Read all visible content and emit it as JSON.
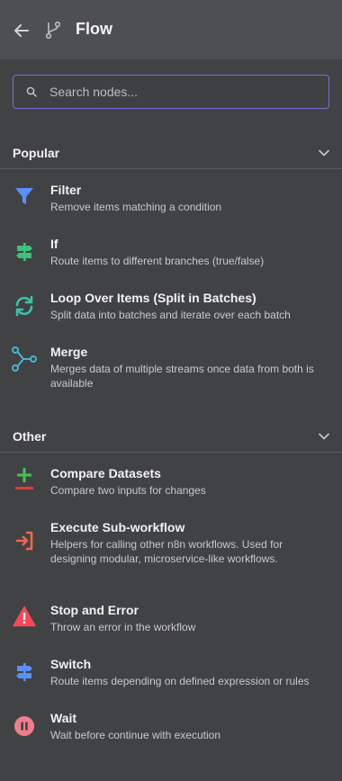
{
  "header": {
    "title": "Flow",
    "back_icon": "arrow-left-icon",
    "flow_icon": "git-branch-icon"
  },
  "search": {
    "placeholder": "Search nodes...",
    "value": ""
  },
  "sections": [
    {
      "label": "Popular",
      "items": [
        {
          "name": "Filter",
          "desc": "Remove items matching a condition",
          "icon": "filter-icon",
          "color": "#5b8ff9"
        },
        {
          "name": "If",
          "desc": "Route items to different branches (true/false)",
          "icon": "signpost-icon",
          "color": "#3cc27a"
        },
        {
          "name": "Loop Over Items (Split in Batches)",
          "desc": "Split data into batches and iterate over each batch",
          "icon": "sync-icon",
          "color": "#3cc2a9"
        },
        {
          "name": "Merge",
          "desc": "Merges data of multiple streams once data from both is available",
          "icon": "merge-icon",
          "color": "#4ab3cf"
        }
      ]
    },
    {
      "label": "Other",
      "items": [
        {
          "name": "Compare Datasets",
          "desc": "Compare two inputs for changes",
          "icon": "plus-minus-icon",
          "color": "#46c353"
        },
        {
          "name": "Execute Sub-workflow",
          "desc": "Helpers for calling other n8n workflows. Used for designing modular, microservice-like workflows.",
          "icon": "sign-in-icon",
          "color": "#f0664f"
        },
        {
          "name": "Stop and Error",
          "desc": "Throw an error in the workflow",
          "icon": "warning-triangle-icon",
          "color": "#f24a58"
        },
        {
          "name": "Switch",
          "desc": "Route items depending on defined expression or rules",
          "icon": "signpost-icon",
          "color": "#5b8ff9"
        },
        {
          "name": "Wait",
          "desc": "Wait before continue with execution",
          "icon": "pause-circle-icon",
          "color": "#f07d8e"
        }
      ]
    }
  ]
}
